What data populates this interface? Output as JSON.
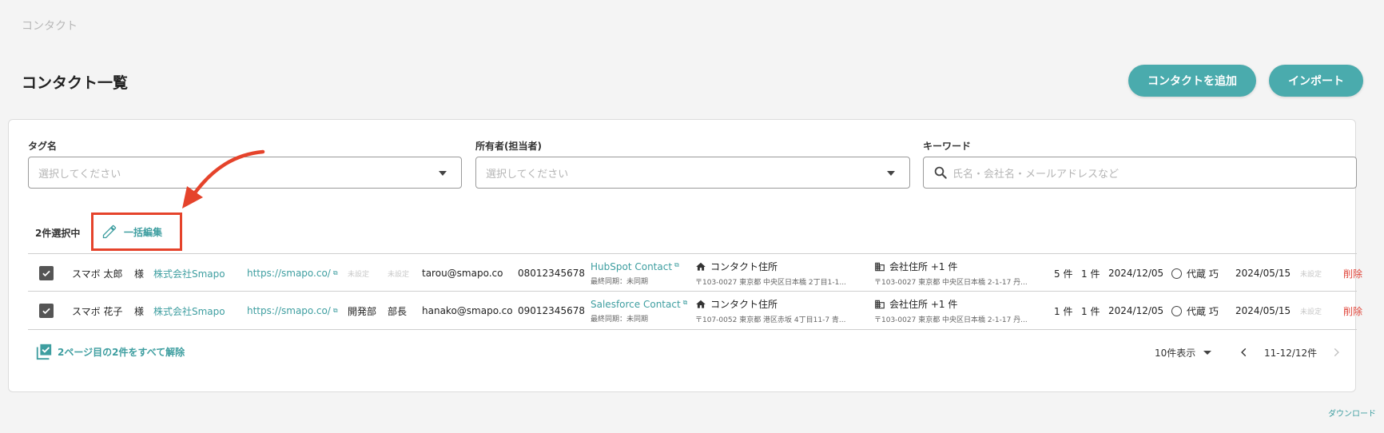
{
  "breadcrumb": "コンタクト",
  "page_title": "コンタクト一覧",
  "header_buttons": {
    "add": "コンタクトを追加",
    "import": "インポート"
  },
  "filters": {
    "tag": {
      "label": "タグ名",
      "placeholder": "選択してください"
    },
    "owner": {
      "label": "所有者(担当者)",
      "placeholder": "選択してください"
    },
    "keyword": {
      "label": "キーワード",
      "placeholder": "氏名・会社名・メールアドレスなど"
    }
  },
  "selection": {
    "count_label": "2件選択中",
    "bulk_edit_label": "一括編集"
  },
  "rows": [
    {
      "name": "スマボ 太郎",
      "honorific": "様",
      "company": "株式会社Smapo",
      "url": "https://smapo.co/",
      "department": "未設定",
      "position": "未設定",
      "email": "tarou@smapo.co",
      "phone": "08012345678",
      "crm_link": "HubSpot Contact",
      "sync_status": "最終同期：未同期",
      "contact_address_title": "コンタクト住所",
      "contact_address": "〒103-0027 東京都 中央区日本橋 2丁目1-1...",
      "company_address_title": "会社住所 +1 件",
      "company_address": "〒103-0027 東京都 中央区日本橋 2-1-17 丹...",
      "count1": "5 件",
      "count2": "1 件",
      "date1": "2024/12/05",
      "owner": "代蔵 巧",
      "date2": "2024/05/15",
      "extra": "未設定",
      "delete": "削除"
    },
    {
      "name": "スマボ 花子",
      "honorific": "様",
      "company": "株式会社Smapo",
      "url": "https://smapo.co/",
      "department": "開発部",
      "position": "部長",
      "email": "hanako@smapo.co",
      "phone": "09012345678",
      "crm_link": "Salesforce Contact",
      "sync_status": "最終同期：未同期",
      "contact_address_title": "コンタクト住所",
      "contact_address": "〒107-0052 東京都 港区赤坂 4丁目11-7 青...",
      "company_address_title": "会社住所 +1 件",
      "company_address": "〒103-0027 東京都 中央区日本橋 2-1-17 丹...",
      "count1": "1 件",
      "count2": "1 件",
      "date1": "2024/12/05",
      "owner": "代蔵 巧",
      "date2": "2024/05/15",
      "extra": "未設定",
      "delete": "削除"
    }
  ],
  "footer": {
    "deselect_label": "2ページ目の2件をすべて解除",
    "page_size": "10件表示",
    "range": "11-12/12件"
  },
  "download": "ダウンロード",
  "colors": {
    "accent": "#4aabad",
    "highlight": "#e5432b",
    "danger": "#e0453a"
  }
}
